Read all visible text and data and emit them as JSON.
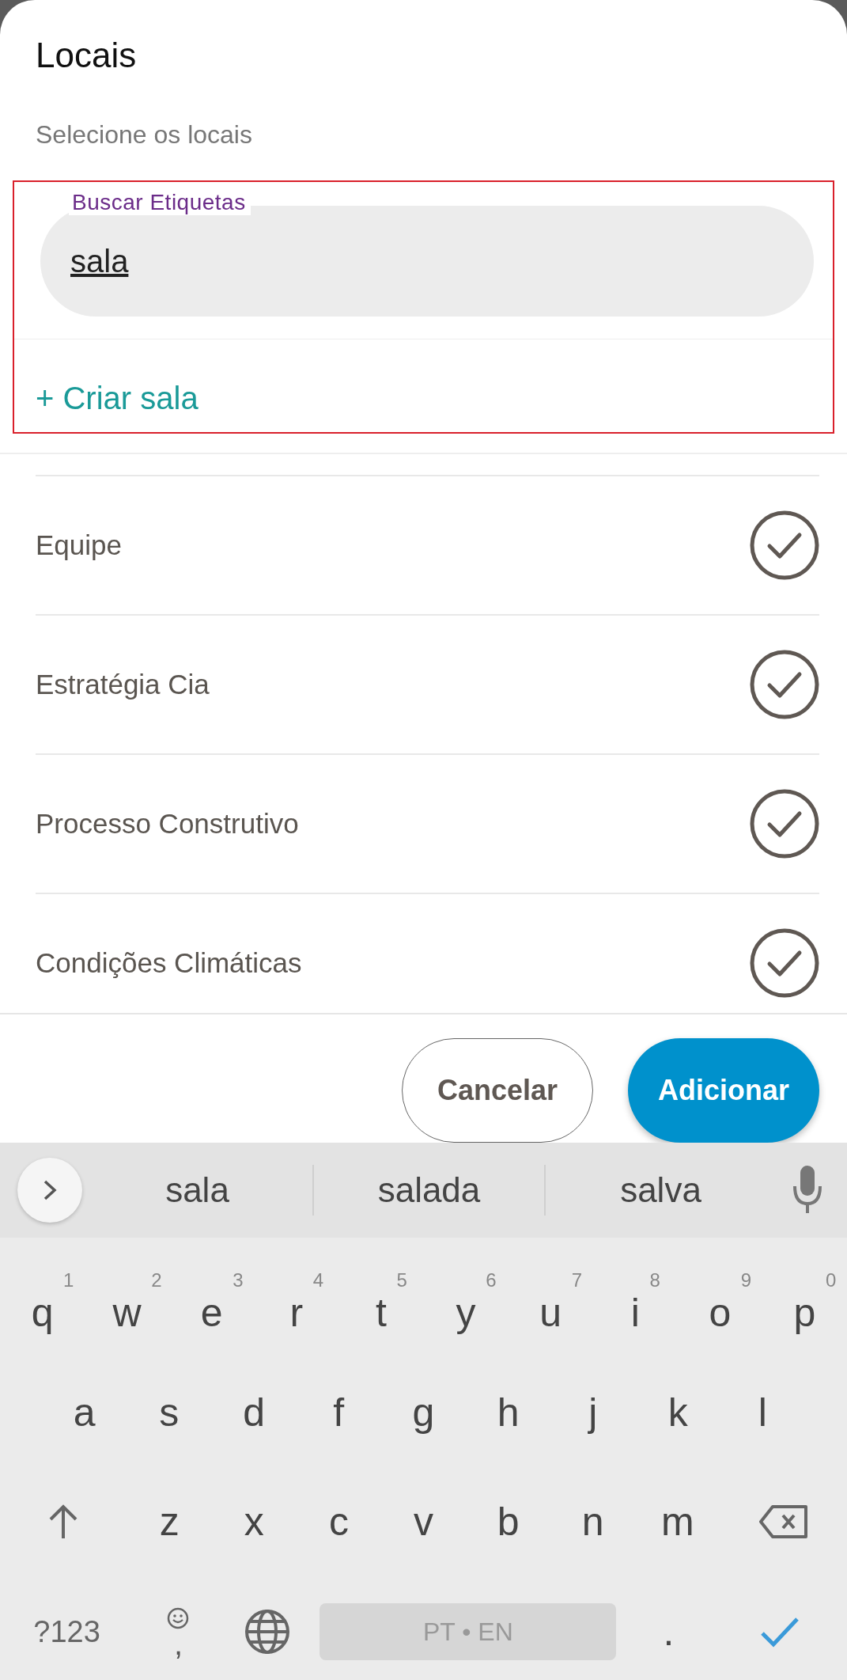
{
  "dialog": {
    "title": "Locais",
    "subtitle": "Selecione os locais"
  },
  "search": {
    "label": "Buscar Etiquetas",
    "value": "sala",
    "highlighted": true
  },
  "create_option": "+ Criar sala",
  "items": [
    {
      "name": "Equipe",
      "checked": true
    },
    {
      "name": "Estratégia Cia",
      "checked": true
    },
    {
      "name": "Processo Construtivo",
      "checked": true
    },
    {
      "name": "Condições Climáticas",
      "checked": true
    }
  ],
  "buttons": [
    {
      "label": "Cancelar",
      "kind": "outline"
    },
    {
      "label": "Adicionar",
      "kind": "primary"
    }
  ],
  "keyboard": {
    "suggestions": [
      "sala",
      "salada",
      "salva"
    ],
    "letter_rows": [
      {
        "keys": [
          {
            "label": "q",
            "hint": "1"
          },
          {
            "label": "w",
            "hint": "2"
          },
          {
            "label": "e",
            "hint": "3"
          },
          {
            "label": "r",
            "hint": "4"
          },
          {
            "label": "t",
            "hint": "5"
          },
          {
            "label": "y",
            "hint": "6"
          },
          {
            "label": "u",
            "hint": "7"
          },
          {
            "label": "i",
            "hint": "8"
          },
          {
            "label": "o",
            "hint": "9"
          },
          {
            "label": "p",
            "hint": "0"
          }
        ]
      },
      {
        "keys": [
          {
            "label": "a"
          },
          {
            "label": "s"
          },
          {
            "label": "d"
          },
          {
            "label": "f"
          },
          {
            "label": "g"
          },
          {
            "label": "h"
          },
          {
            "label": "j"
          },
          {
            "label": "k"
          },
          {
            "label": "l"
          }
        ]
      },
      {
        "keys": [
          {
            "label": "z"
          },
          {
            "label": "x"
          },
          {
            "label": "c"
          },
          {
            "label": "v"
          },
          {
            "label": "b"
          },
          {
            "label": "n"
          },
          {
            "label": "m"
          }
        ]
      }
    ],
    "bottom_row": {
      "symbols_key": "?123",
      "comma_key": ",",
      "space_bar": "PT • EN",
      "period_key": "."
    }
  }
}
